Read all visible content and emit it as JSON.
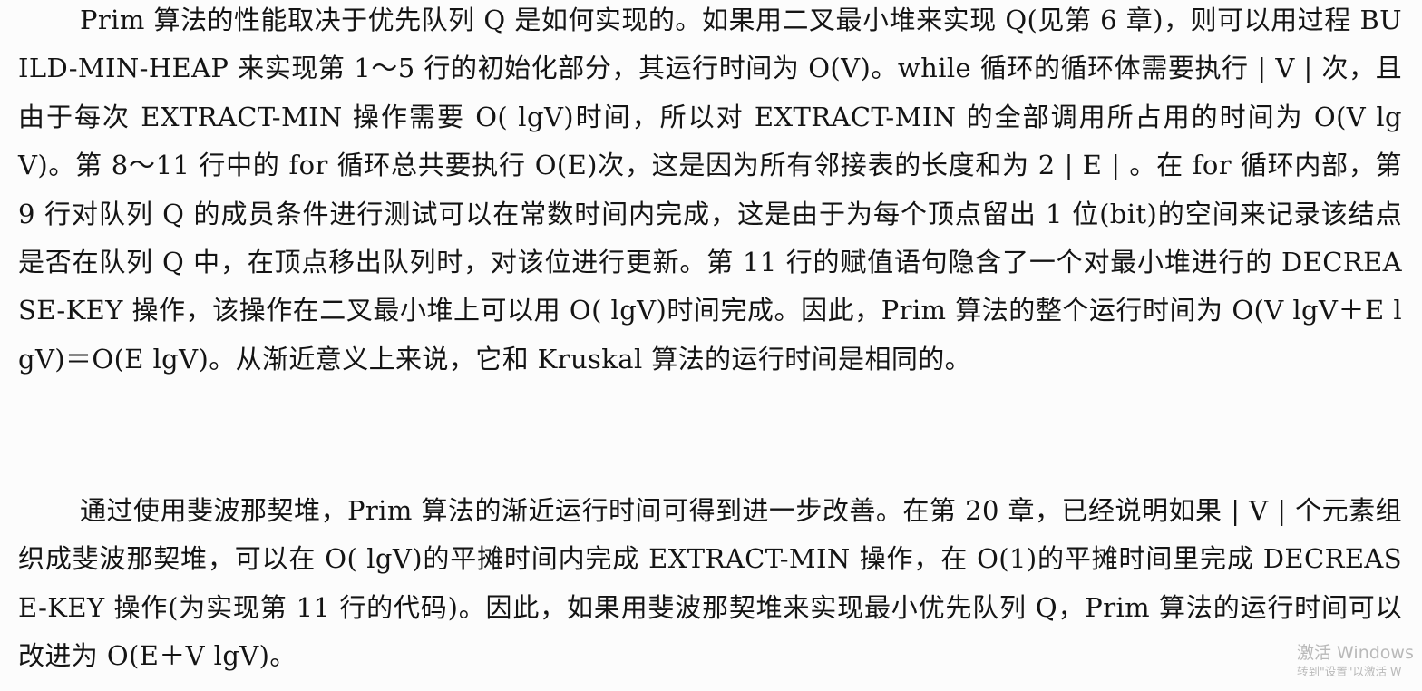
{
  "document": {
    "paragraph_1": "Prim 算法的性能取决于优先队列 Q 是如何实现的。如果用二叉最小堆来实现 Q(见第 6 章)，则可以用过程 BUILD-MIN-HEAP 来实现第 1～5 行的初始化部分，其运行时间为 O(V)。while 循环的循环体需要执行 | V | 次，且由于每次 EXTRACT-MIN 操作需要 O( lgV)时间，所以对 EXTRACT-MIN 的全部调用所占用的时间为 O(V lgV)。第 8～11 行中的 for 循环总共要执行 O(E)次，这是因为所有邻接表的长度和为 2 | E | 。在 for 循环内部，第 9 行对队列 Q 的成员条件进行测试可以在常数时间内完成，这是由于为每个顶点留出 1 位(bit)的空间来记录该结点是否在队列 Q 中，在顶点移出队列时，对该位进行更新。第 11 行的赋值语句隐含了一个对最小堆进行的 DECREASE-KEY 操作，该操作在二叉最小堆上可以用 O( lgV)时间完成。因此，Prim 算法的整个运行时间为 O(V lgV＋E lgV)＝O(E lgV)。从渐近意义上来说，它和 Kruskal 算法的运行时间是相同的。",
    "paragraph_2": "通过使用斐波那契堆，Prim 算法的渐近运行时间可得到进一步改善。在第 20 章，已经说明如果 | V | 个元素组织成斐波那契堆，可以在 O( lgV)的平摊时间内完成 EXTRACT-MIN 操作，在 O(1)的平摊时间里完成 DECREASE-KEY 操作(为实现第 11 行的代码)。因此，如果用斐波那契堆来实现最小优先队列 Q，Prim 算法的运行时间可以改进为 O(E＋V lgV)。"
  },
  "watermark": {
    "title": "激活 Windows",
    "subtitle": "转到\"设置\"以激活 W"
  }
}
